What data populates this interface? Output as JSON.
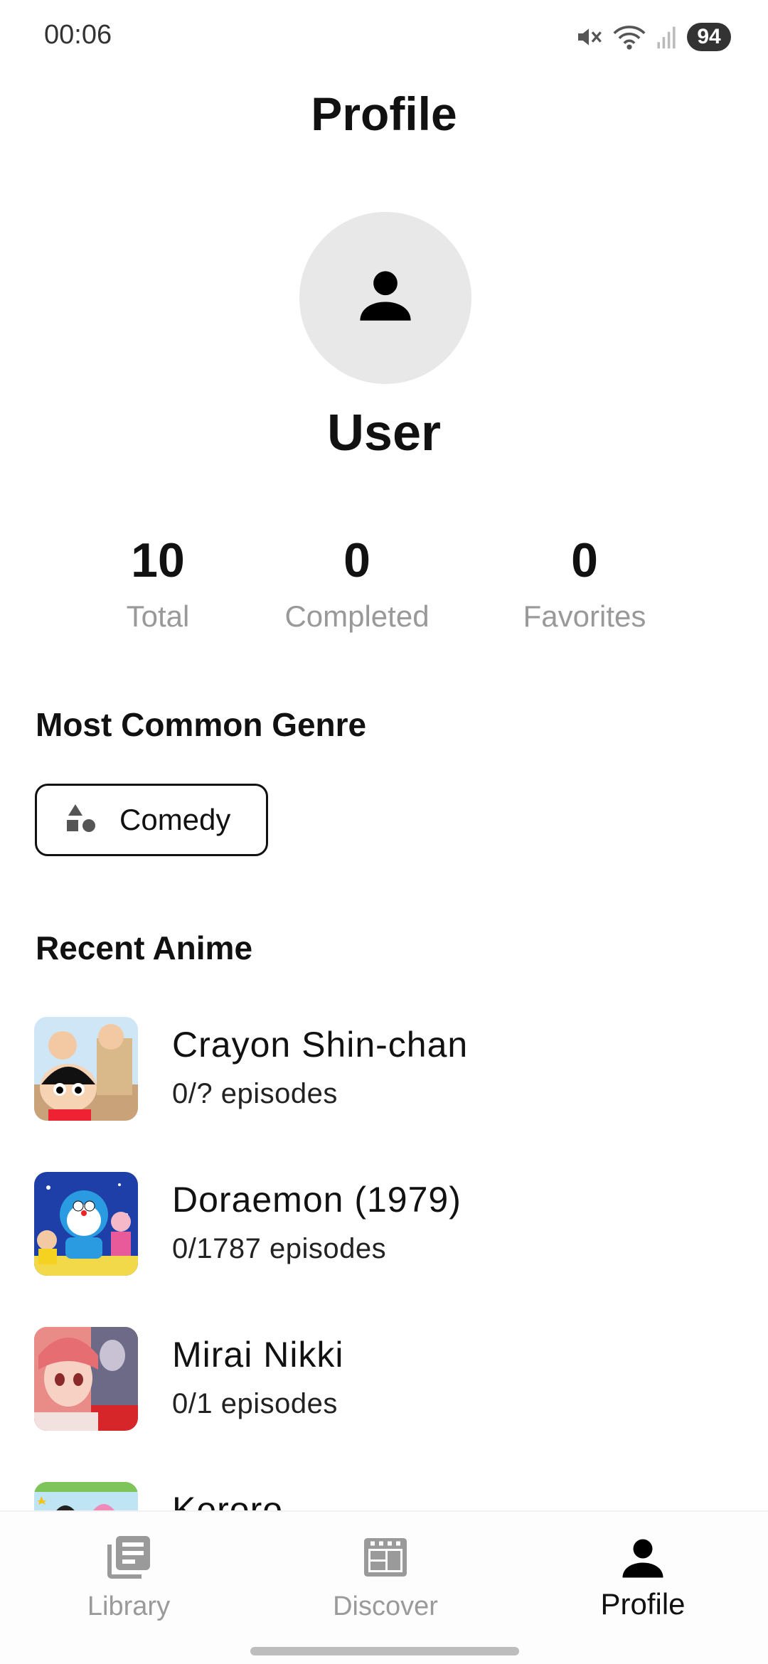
{
  "status_bar": {
    "time": "00:06",
    "battery": "94",
    "icons": [
      "mute-icon",
      "wifi-icon",
      "signal-icon",
      "battery-icon"
    ]
  },
  "header": {
    "title": "Profile"
  },
  "profile": {
    "avatar_icon": "person-icon",
    "username": "User"
  },
  "stats": [
    {
      "value": "10",
      "label": "Total"
    },
    {
      "value": "0",
      "label": "Completed"
    },
    {
      "value": "0",
      "label": "Favorites"
    }
  ],
  "genre_section": {
    "title": "Most Common Genre",
    "genre_icon": "shapes-icon",
    "genre": "Comedy"
  },
  "recent_section": {
    "title": "Recent Anime",
    "items": [
      {
        "title": "Crayon Shin-chan",
        "episodes": "0/? episodes"
      },
      {
        "title": "Doraemon (1979)",
        "episodes": "0/1787 episodes"
      },
      {
        "title": "Mirai Nikki",
        "episodes": "0/1 episodes"
      },
      {
        "title": "Keroro",
        "episodes": ""
      }
    ]
  },
  "bottom_nav": {
    "items": [
      {
        "label": "Library",
        "icon": "library-icon",
        "active": false
      },
      {
        "label": "Discover",
        "icon": "discover-icon",
        "active": false
      },
      {
        "label": "Profile",
        "icon": "person-icon",
        "active": true
      }
    ]
  },
  "colors": {
    "text_primary": "#111111",
    "text_secondary": "#999999",
    "avatar_bg": "#e8e8e8",
    "nav_inactive": "#9a9a9a"
  }
}
